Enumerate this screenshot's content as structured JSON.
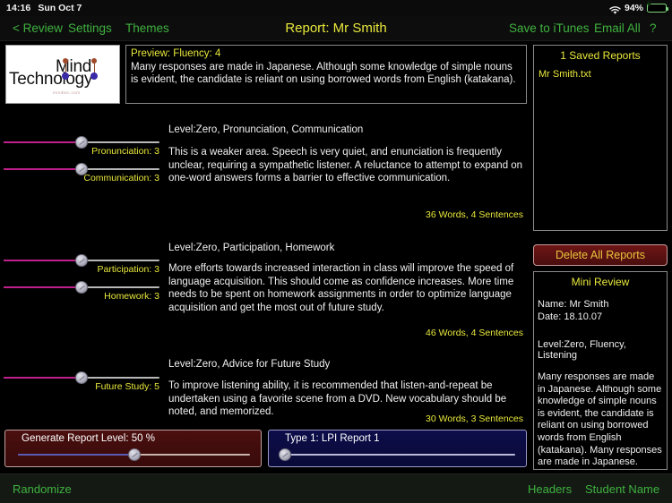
{
  "statusbar": {
    "time": "14:16",
    "date": "Sun Oct 7",
    "battery_percent": "94%",
    "wifi_icon": "wifi-icon",
    "battery_icon": "battery-charging-icon"
  },
  "navbar": {
    "back_label": "< Review",
    "settings_label": "Settings",
    "themes_label": "Themes",
    "title": "Report: Mr Smith",
    "save_itunes_label": "Save to iTunes",
    "email_all_label": "Email All",
    "help_label": "?"
  },
  "logo": {
    "line1": "Technology",
    "line2": "Mind",
    "url": "mindtec.com"
  },
  "preview": {
    "title": "Preview:  Fluency: 4",
    "body": "Many responses are made in Japanese. Although some knowledge of simple nouns is evident, the candidate is reliant on using borrowed words from English (katakana)."
  },
  "saved": {
    "title": "1 Saved Reports",
    "items": [
      "Mr Smith.txt"
    ],
    "delete_label": "Delete All Reports"
  },
  "mini_review": {
    "title": "Mini Review",
    "name": "Name: Mr Smith",
    "date": "Date: 18.10.07",
    "level": "Level:Zero, Fluency, Listening",
    "body": "Many responses are made in Japanese. Although some knowledge of simple nouns is evident, the candidate is reliant on using borrowed words from English (katakana). Many responses are made in Japanese. Although some knowledge of simple nouns is evident, the candidate is reliant"
  },
  "sections": [
    {
      "heading": "Level:Zero, Pronunciation, Communication",
      "body": "This is a weaker area. Speech is very quiet, and enunciation is frequently unclear, requiring a sympathetic listener. A reluctance to attempt to expand on one-word answers forms a barrier to effective communication.",
      "count": "36 Words, 4 Sentences",
      "sliders": [
        {
          "label": "Pronunciation: 3",
          "value": 3,
          "percent": 50
        },
        {
          "label": "Communication: 3",
          "value": 3,
          "percent": 50
        }
      ]
    },
    {
      "heading": "Level:Zero, Participation, Homework",
      "body": "More efforts towards increased interaction in class will improve the speed of language acquisition. This should come as confidence increases. More time needs to be spent on homework assignments in order to optimize language acquisition and get the most out of future study.",
      "count": "46 Words, 4 Sentences",
      "sliders": [
        {
          "label": "Participation: 3",
          "value": 3,
          "percent": 50
        },
        {
          "label": "Homework: 3",
          "value": 3,
          "percent": 50
        }
      ]
    },
    {
      "heading": "Level:Zero, Advice for Future Study",
      "body": "To improve listening ability, it is recommended that listen-and-repeat be undertaken using a favorite scene from a DVD. New vocabulary should be noted, and memorized.",
      "count": "30 Words, 3 Sentences",
      "sliders": [
        {
          "label": "Future Study: 5",
          "value": 5,
          "percent": 50
        }
      ]
    }
  ],
  "bottom_panels": {
    "report_level": {
      "label": "Generate Report Level: 50 %",
      "percent": 50
    },
    "report_type": {
      "label": "Type 1: LPI Report 1",
      "percent": 1
    }
  },
  "toolbar": {
    "randomize_label": "Randomize",
    "headers_label": "Headers",
    "student_name_label": "Student Name"
  },
  "colors": {
    "accent_green": "#3fb23f",
    "accent_yellow": "#e8e83c",
    "slider_fill": "#c01f8c",
    "panel_red": "#4b0f0f",
    "panel_blue": "#0d0d4a"
  }
}
